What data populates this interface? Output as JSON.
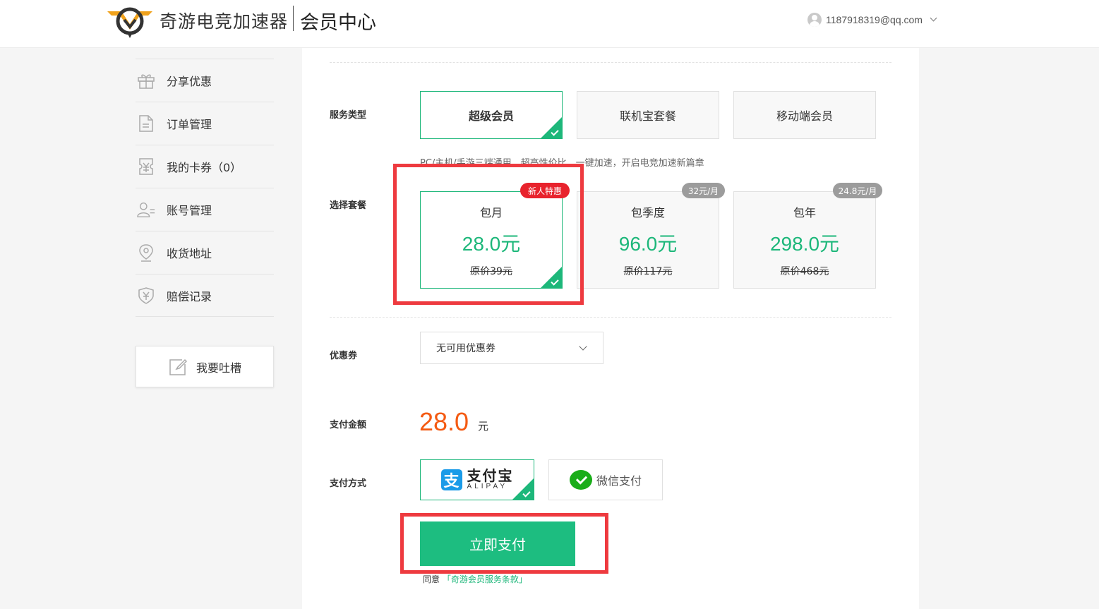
{
  "header": {
    "brand_name": "奇游电竞加速器",
    "section_title": "会员中心",
    "user_email": "1187918319@qq.com",
    "icons": {
      "logo": "qiyou-logo",
      "avatar": "user-avatar-icon",
      "chevron": "chevron-down-icon"
    }
  },
  "sidebar": {
    "items": [
      {
        "label": "分享优惠",
        "icon": "gift-icon"
      },
      {
        "label": "订单管理",
        "icon": "document-icon"
      },
      {
        "label": "我的卡券（0）",
        "icon": "coupon-icon"
      },
      {
        "label": "账号管理",
        "icon": "user-list-icon"
      },
      {
        "label": "收货地址",
        "icon": "location-pin-icon"
      },
      {
        "label": "赔偿记录",
        "icon": "shield-yen-icon"
      }
    ],
    "feedback_label": "我要吐槽"
  },
  "main": {
    "service_type_label": "服务类型",
    "service_types": [
      {
        "label": "超级会员",
        "selected": true
      },
      {
        "label": "联机宝套餐",
        "selected": false
      },
      {
        "label": "移动端会员",
        "selected": false
      }
    ],
    "service_desc": "PC/主机/手游三端通用，超高性价比，一键加速，开启电竞加速新篇章",
    "plan_label": "选择套餐",
    "plans": [
      {
        "name": "包月",
        "price": "28.0元",
        "original": "原价39元",
        "badge": "新人特惠",
        "selected": true
      },
      {
        "name": "包季度",
        "price": "96.0元",
        "original": "原价117元",
        "badge": "32元/月",
        "selected": false
      },
      {
        "name": "包年",
        "price": "298.0元",
        "original": "原价468元",
        "badge": "24.8元/月",
        "selected": false
      }
    ],
    "coupon_label": "优惠券",
    "coupon_value": "无可用优惠券",
    "amount_label": "支付金额",
    "amount_value": "28.0",
    "amount_unit": "元",
    "method_label": "支付方式",
    "methods": [
      {
        "cn": "支付宝",
        "en": "ALIPAY",
        "selected": true
      },
      {
        "label": "微信支付",
        "selected": false
      }
    ],
    "pay_button": "立即支付",
    "terms_prefix": "同意",
    "terms_link": "「奇游会员服务条款」"
  },
  "colors": {
    "accent_green": "#1db77a",
    "pay_button": "#1dbd80",
    "price_orange": "#f45a12",
    "badge_red": "#e8232d",
    "badge_gray": "#9c9c9c",
    "annotation_red": "#ee3a3f"
  }
}
